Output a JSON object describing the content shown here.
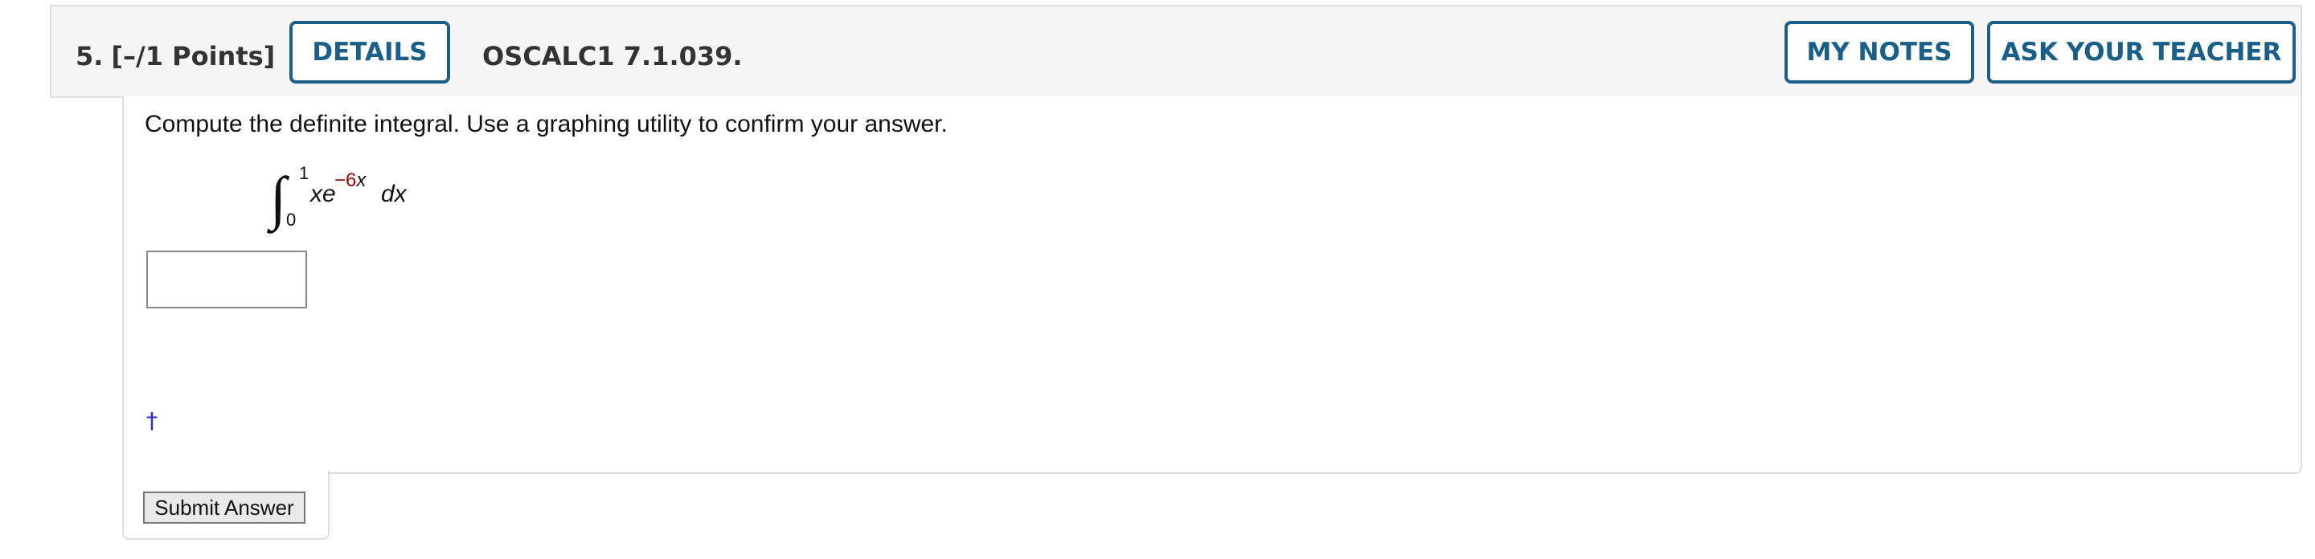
{
  "question": {
    "number": "5.",
    "points": "[–/1 Points]",
    "code": "OSCALC1 7.1.039.",
    "prompt": "Compute the definite integral. Use a graphing utility to confirm your answer."
  },
  "header_buttons": {
    "details": "DETAILS",
    "my_notes": "MY NOTES",
    "ask_teacher": "ASK YOUR TEACHER"
  },
  "integral": {
    "sign": "∫",
    "upper_limit": "1",
    "lower_limit": "0",
    "integrand_base": "xe",
    "exponent_coefficient": "−6",
    "exponent_variable": "x",
    "differential": "dx"
  },
  "answer": {
    "value": ""
  },
  "footnote_marker": "†",
  "submit_label": "Submit Answer",
  "colors": {
    "button_border": "#1a5f8a",
    "exponent_coefficient": "#b00000",
    "footnote_link": "#2a2ad8",
    "header_background": "#f5f5f5"
  }
}
